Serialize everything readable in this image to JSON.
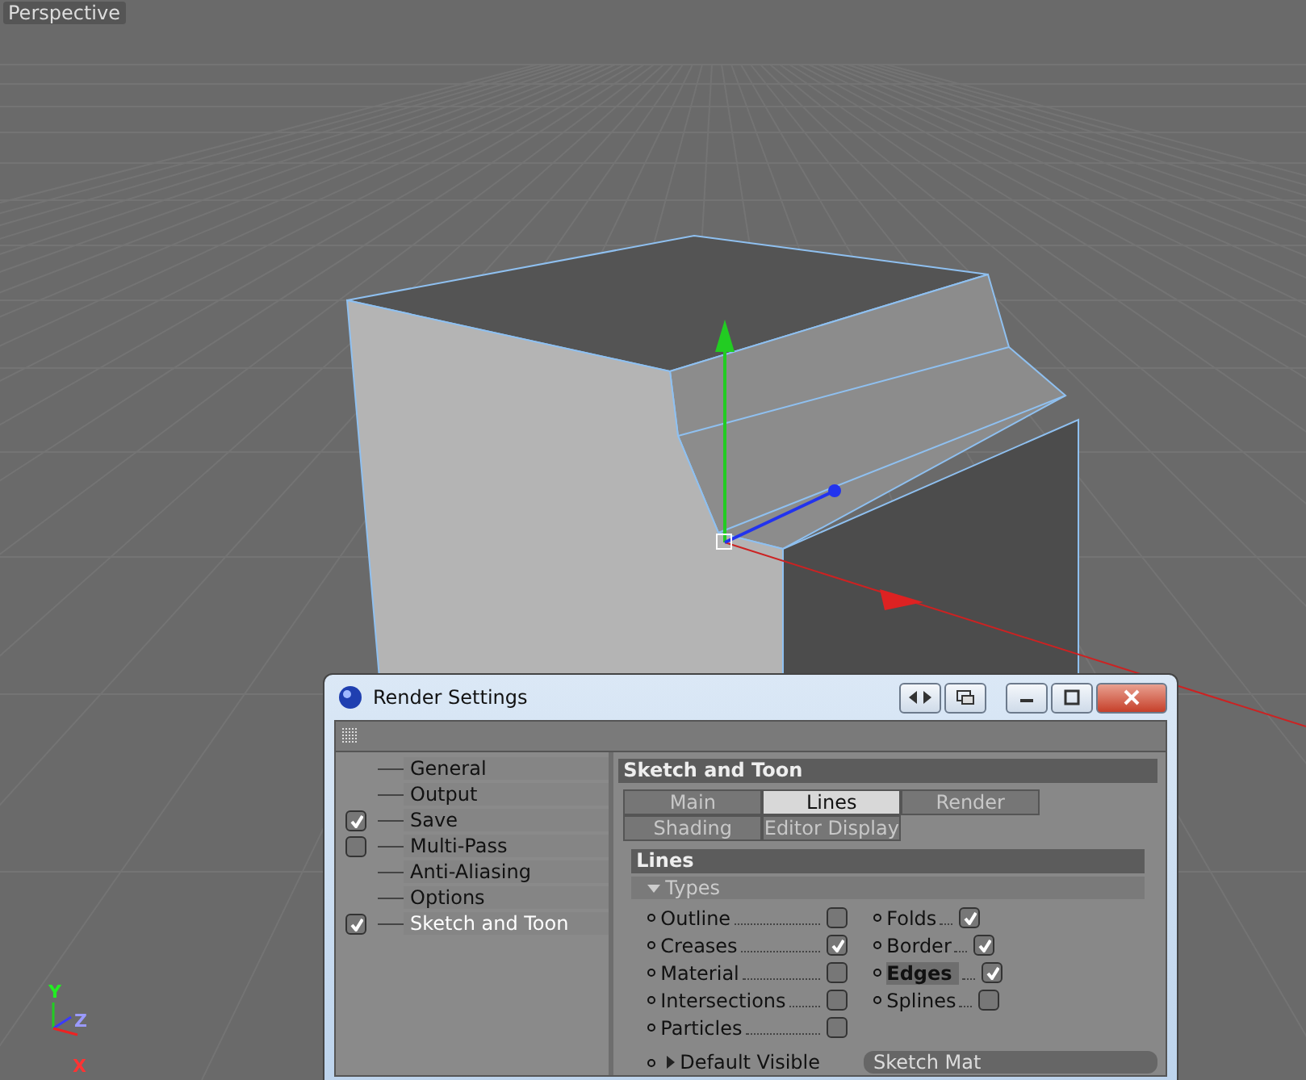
{
  "viewport": {
    "label": "Perspective",
    "axes": [
      {
        "label": "Y",
        "kind": "y"
      },
      {
        "label": "Z",
        "kind": "z"
      },
      {
        "label": "X",
        "kind": "x"
      }
    ]
  },
  "dialog": {
    "title": "Render Settings",
    "sidebar": {
      "items": [
        {
          "label": "General",
          "kind": "plain",
          "selected": false
        },
        {
          "label": "Output",
          "kind": "plain",
          "selected": false
        },
        {
          "label": "Save",
          "kind": "toggle",
          "checked": true,
          "selected": false
        },
        {
          "label": "Multi-Pass",
          "kind": "toggle",
          "checked": false,
          "selected": false
        },
        {
          "label": "Anti-Aliasing",
          "kind": "plain",
          "selected": false
        },
        {
          "label": "Options",
          "kind": "plain",
          "selected": false
        },
        {
          "label": "Sketch and Toon",
          "kind": "toggle",
          "checked": true,
          "selected": true
        }
      ]
    },
    "panel": {
      "title": "Sketch and Toon",
      "tabs": [
        [
          {
            "label": "Main",
            "selected": false
          },
          {
            "label": "Lines",
            "selected": true
          },
          {
            "label": "Render",
            "selected": false
          }
        ],
        [
          {
            "label": "Shading",
            "selected": false
          },
          {
            "label": "Editor Display",
            "selected": false
          }
        ]
      ],
      "group": "Lines",
      "subgroup": {
        "label": "Types",
        "expanded": true
      },
      "options": [
        [
          {
            "label": "Outline",
            "checked": false,
            "selected": false
          },
          {
            "label": "Creases",
            "checked": true,
            "selected": false
          },
          {
            "label": "Material",
            "checked": false,
            "selected": false
          },
          {
            "label": "Intersections",
            "checked": false,
            "selected": false
          },
          {
            "label": "Particles",
            "checked": false,
            "selected": false
          }
        ],
        [
          {
            "label": "Folds",
            "checked": true,
            "selected": false
          },
          {
            "label": "Border",
            "checked": true,
            "selected": false
          },
          {
            "label": "Edges",
            "checked": true,
            "selected": true
          },
          {
            "label": "Splines",
            "checked": false,
            "selected": false
          }
        ]
      ],
      "link": {
        "label": "Default Visible",
        "expanded": false,
        "value": "Sketch Mat"
      }
    }
  }
}
